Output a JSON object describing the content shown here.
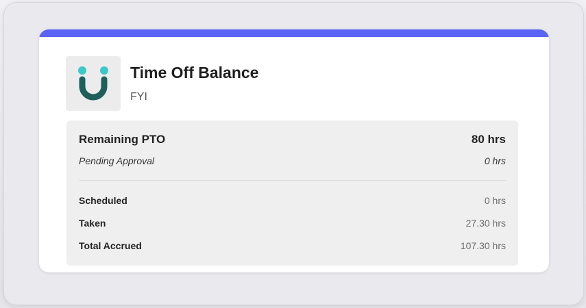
{
  "card": {
    "title": "Time Off Balance",
    "subtitle": "FYI",
    "accent_color": "#5b63f5",
    "logo": {
      "icon": "smile-logo-icon",
      "eye_color": "#3cc8c8",
      "mouth_color": "#1e5f5a"
    }
  },
  "balance": {
    "remaining": {
      "label": "Remaining PTO",
      "value": "80 hrs"
    },
    "pending": {
      "label": "Pending Approval",
      "value": "0 hrs"
    },
    "details": [
      {
        "label": "Scheduled",
        "value": "0 hrs"
      },
      {
        "label": "Taken",
        "value": "27.30 hrs"
      },
      {
        "label": "Total Accrued",
        "value": "107.30 hrs"
      }
    ]
  }
}
